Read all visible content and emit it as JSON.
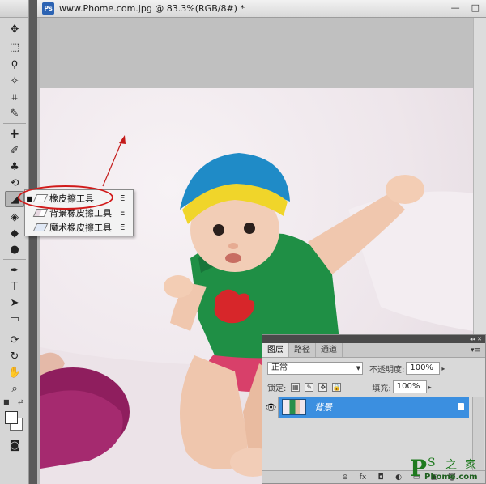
{
  "document": {
    "app_icon_text": "Ps",
    "title": "www.Phome.com.jpg @ 83.3%(RGB/8#) *",
    "window_controls": [
      "—",
      "□"
    ]
  },
  "toolbox": {
    "tools": [
      {
        "name": "move-tool",
        "glyph": "✥"
      },
      {
        "name": "marquee-tool",
        "glyph": "⬚"
      },
      {
        "name": "lasso-tool",
        "glyph": "ϙ"
      },
      {
        "name": "magic-wand-tool",
        "glyph": "✧"
      },
      {
        "name": "crop-tool",
        "glyph": "⌗"
      },
      {
        "name": "eyedropper-tool",
        "glyph": "✎"
      },
      {
        "name": "healing-brush-tool",
        "glyph": "✚"
      },
      {
        "name": "brush-tool",
        "glyph": "✐"
      },
      {
        "name": "clone-stamp-tool",
        "glyph": "♣"
      },
      {
        "name": "history-brush-tool",
        "glyph": "⟲"
      },
      {
        "name": "eraser-tool",
        "glyph": "◢"
      },
      {
        "name": "paint-bucket-tool",
        "glyph": "◈"
      },
      {
        "name": "blur-tool",
        "glyph": "◆"
      },
      {
        "name": "dodge-tool",
        "glyph": "●"
      },
      {
        "name": "pen-tool",
        "glyph": "✒"
      },
      {
        "name": "type-tool",
        "glyph": "T"
      },
      {
        "name": "path-selection-tool",
        "glyph": "➤"
      },
      {
        "name": "shape-tool",
        "glyph": "▭"
      },
      {
        "name": "3d-rotate-tool",
        "glyph": "⟳"
      },
      {
        "name": "3d-orbit-tool",
        "glyph": "↻"
      },
      {
        "name": "hand-tool",
        "glyph": "✋"
      },
      {
        "name": "zoom-tool",
        "glyph": "⌕"
      }
    ],
    "quick_mask_glyph": "◙"
  },
  "flyout": {
    "items": [
      {
        "label": "橡皮擦工具",
        "shortcut": "E",
        "selected": true
      },
      {
        "label": "背景橡皮擦工具",
        "shortcut": "E",
        "selected": false
      },
      {
        "label": "魔术橡皮擦工具",
        "shortcut": "E",
        "selected": false
      }
    ],
    "bullet": "■"
  },
  "layers_panel": {
    "collapse_glyph": "◂◂ ✕",
    "tabs": [
      {
        "label": "图层",
        "active": true
      },
      {
        "label": "路径",
        "active": false
      },
      {
        "label": "通道",
        "active": false
      }
    ],
    "menu_glyph": "▾≡",
    "blend_mode": "正常",
    "opacity_label": "不透明度:",
    "opacity_value": "100%",
    "lock_label": "锁定:",
    "fill_label": "填充:",
    "fill_value": "100%",
    "layer_name": "背景",
    "eye_glyph": "👁",
    "bottom_icons": [
      "⊖",
      "fx",
      "◘",
      "◐",
      "▭",
      "▣",
      "🗑"
    ]
  },
  "watermark": {
    "big": "P",
    "s": "S",
    "zhi": "之",
    "jia": "家",
    "url": "Phome.com"
  },
  "colors": {
    "annotation_red": "#d11a1a",
    "layer_highlight": "#3b8fe0",
    "watermark_green": "#1f7a1f"
  }
}
